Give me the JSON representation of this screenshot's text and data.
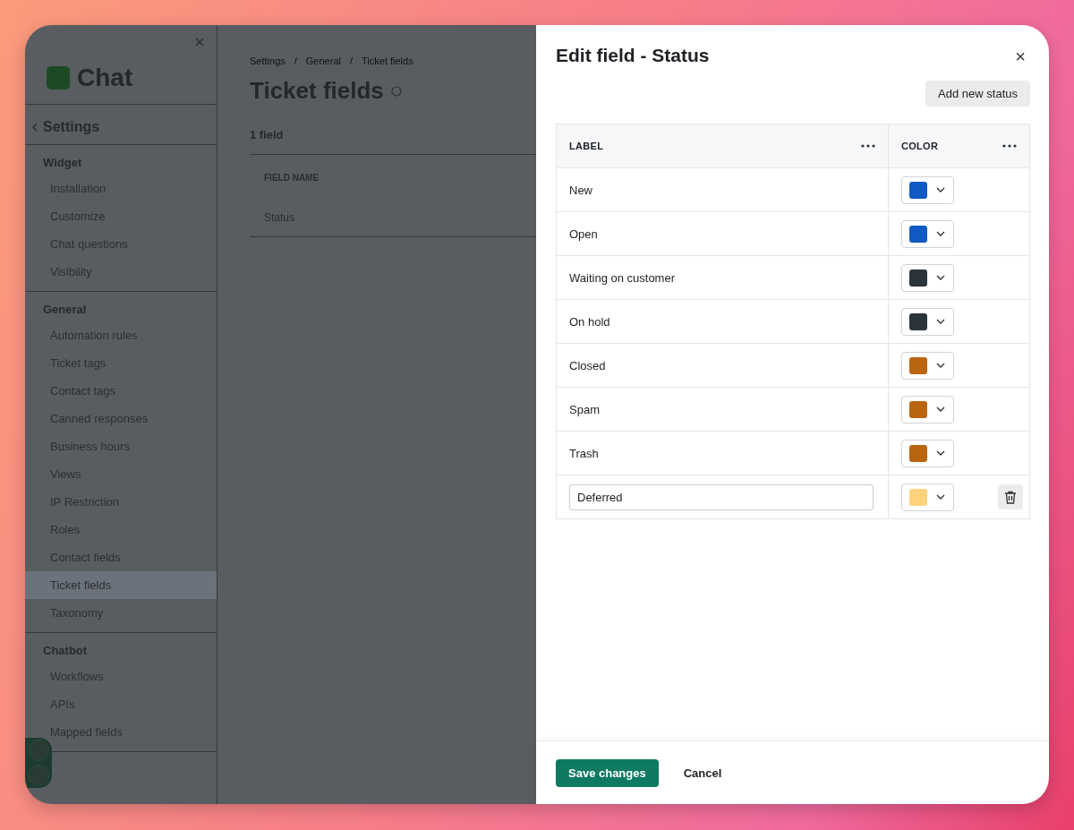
{
  "sidebar": {
    "logo": "Chat",
    "back_label": "Settings",
    "sections": [
      {
        "title": "Widget",
        "items": [
          {
            "label": "Installation",
            "selected": false
          },
          {
            "label": "Customize",
            "selected": false
          },
          {
            "label": "Chat questions",
            "selected": false
          },
          {
            "label": "Visibility",
            "selected": false
          }
        ]
      },
      {
        "title": "General",
        "items": [
          {
            "label": "Automation rules",
            "selected": false
          },
          {
            "label": "Ticket tags",
            "selected": false
          },
          {
            "label": "Contact tags",
            "selected": false
          },
          {
            "label": "Canned responses",
            "selected": false
          },
          {
            "label": "Business hours",
            "selected": false
          },
          {
            "label": "Views",
            "selected": false
          },
          {
            "label": "IP Restriction",
            "selected": false
          },
          {
            "label": "Roles",
            "selected": false
          },
          {
            "label": "Contact fields",
            "selected": false
          },
          {
            "label": "Ticket fields",
            "selected": true
          },
          {
            "label": "Taxonomy",
            "selected": false
          }
        ]
      },
      {
        "title": "Chatbot",
        "items": [
          {
            "label": "Workflows",
            "selected": false
          },
          {
            "label": "APIs",
            "selected": false
          },
          {
            "label": "Mapped fields",
            "selected": false
          }
        ]
      }
    ]
  },
  "main": {
    "breadcrumb": [
      "Settings",
      "General",
      "Ticket fields"
    ],
    "breadcrumb_separator": "/",
    "title": "Ticket fields",
    "count": "1 field",
    "table": {
      "columns": [
        "FIELD NAME"
      ],
      "rows": [
        [
          "Status"
        ]
      ]
    }
  },
  "modal": {
    "title": "Edit field - Status",
    "close": "×",
    "add_button": "Add new status",
    "columns": [
      "LABEL",
      "COLOR"
    ],
    "rows": [
      {
        "kind": "text",
        "label": "New",
        "color": "#1259c3"
      },
      {
        "kind": "text",
        "label": "Open",
        "color": "#1259c3"
      },
      {
        "kind": "text",
        "label": "Waiting on customer",
        "color": "#2b333b"
      },
      {
        "kind": "text",
        "label": "On hold",
        "color": "#2b333b"
      },
      {
        "kind": "text",
        "label": "Closed",
        "color": "#b9650f"
      },
      {
        "kind": "text",
        "label": "Spam",
        "color": "#b9650f"
      },
      {
        "kind": "text",
        "label": "Trash",
        "color": "#b9650f"
      },
      {
        "kind": "input",
        "label": "Deferred",
        "color": "#fdd27a"
      }
    ],
    "save_button": "Save changes",
    "cancel_button": "Cancel"
  }
}
